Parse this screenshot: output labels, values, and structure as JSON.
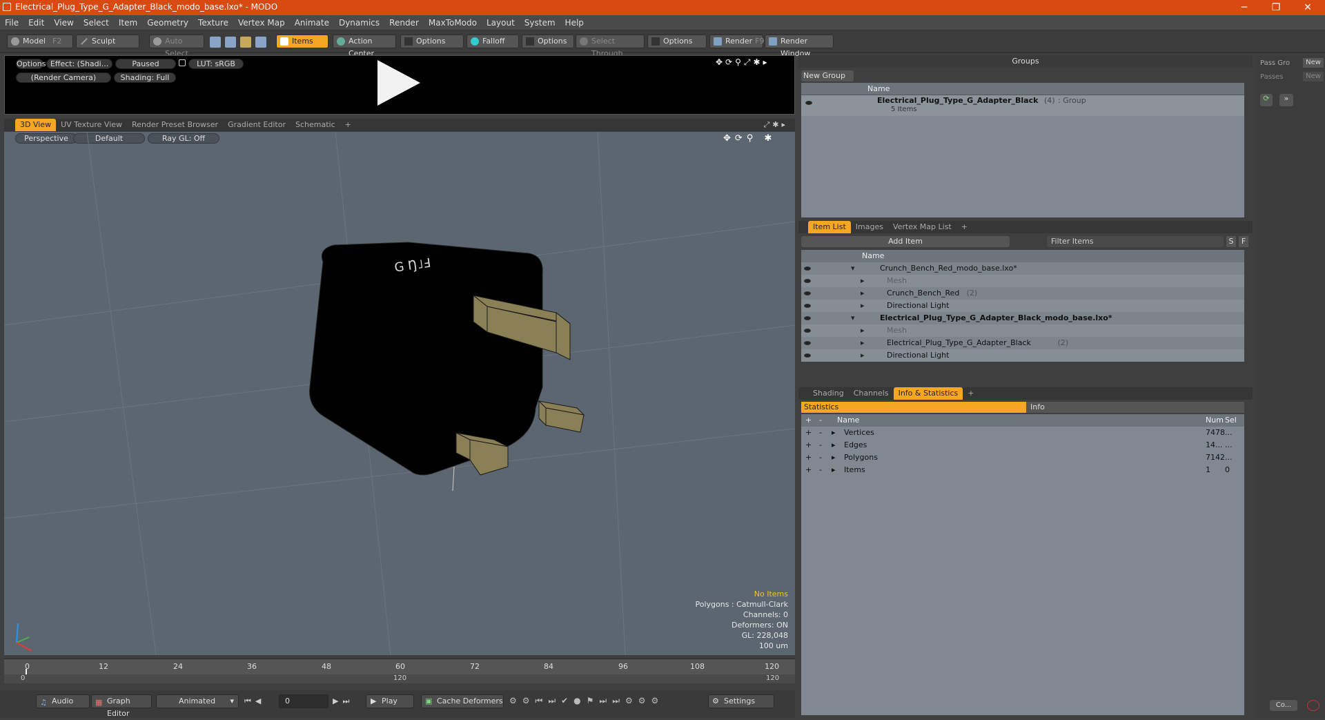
{
  "window": {
    "title": "Electrical_Plug_Type_G_Adapter_Black_modo_base.lxo* - MODO"
  },
  "menu": [
    "File",
    "Edit",
    "View",
    "Select",
    "Item",
    "Geometry",
    "Texture",
    "Vertex Map",
    "Animate",
    "Dynamics",
    "Render",
    "MaxToModo",
    "Layout",
    "System",
    "Help"
  ],
  "toolbar": {
    "model": "Model",
    "model_key": "F2",
    "sculpt": "Sculpt",
    "auto_select": "Auto Select",
    "items": "Items",
    "action_center": "Action Center",
    "options1": "Options",
    "falloff": "Falloff",
    "options2": "Options",
    "select_through": "Select Through",
    "options3": "Options",
    "render": "Render",
    "render_key": "F9",
    "render_window": "Render Window"
  },
  "preview": {
    "options": "Options",
    "effect": "Effect: (Shadi...",
    "paused": "Paused",
    "lut": "LUT: sRGB",
    "camera": "(Render Camera)",
    "shading": "Shading: Full"
  },
  "viewtabs": [
    "3D View",
    "UV Texture View",
    "Render Preset Browser",
    "Gradient Editor",
    "Schematic",
    "+"
  ],
  "viewport": {
    "perspective": "Perspective",
    "default": "Default",
    "raygl": "Ray GL: Off",
    "plug_text": "G Ŋ˩Ⅎ",
    "stats": [
      "No Items",
      "Polygons : Catmull-Clark",
      "Channels: 0",
      "Deformers: ON",
      "GL: 228,048",
      "100 um"
    ]
  },
  "timeline": {
    "ticks": [
      "0",
      "12",
      "24",
      "36",
      "48",
      "60",
      "72",
      "84",
      "96",
      "108",
      "120"
    ],
    "sub_start": "0",
    "sub_mid": "120",
    "sub_end": "120"
  },
  "bottom": {
    "audio": "Audio",
    "graph_editor": "Graph Editor",
    "animated": "Animated",
    "frame": "0",
    "play": "Play",
    "cache": "Cache Deformers",
    "settings": "Settings"
  },
  "groups": {
    "title": "Groups",
    "new_group": "New Group",
    "col_name": "Name",
    "item_name": "Electrical_Plug_Type_G_Adapter_Black",
    "item_count": "(4)",
    "item_type": ": Group",
    "item_sub": "5 Items"
  },
  "itemlist": {
    "tabs": [
      "Item List",
      "Images",
      "Vertex Map List",
      "+"
    ],
    "add_item": "Add Item",
    "filter": "Filter Items",
    "s": "S",
    "f": "F",
    "col_name": "Name",
    "rows": [
      {
        "label": "Crunch_Bench_Red_modo_base.lxo*",
        "indent": 0,
        "dim": false,
        "bold": false,
        "count": ""
      },
      {
        "label": "Mesh",
        "indent": 1,
        "dim": true,
        "bold": false,
        "count": ""
      },
      {
        "label": "Crunch_Bench_Red",
        "indent": 1,
        "dim": false,
        "bold": false,
        "count": "(2)"
      },
      {
        "label": "Directional Light",
        "indent": 1,
        "dim": false,
        "bold": false,
        "count": ""
      },
      {
        "label": "Electrical_Plug_Type_G_Adapter_Black_modo_base.lxo*",
        "indent": 0,
        "dim": false,
        "bold": true,
        "count": ""
      },
      {
        "label": "Mesh",
        "indent": 1,
        "dim": true,
        "bold": false,
        "count": ""
      },
      {
        "label": "Electrical_Plug_Type_G_Adapter_Black",
        "indent": 1,
        "dim": false,
        "bold": false,
        "count": "(2)"
      },
      {
        "label": "Directional Light",
        "indent": 1,
        "dim": false,
        "bold": false,
        "count": ""
      }
    ]
  },
  "stats_panel": {
    "tabs": [
      "Shading",
      "Channels",
      "Info & Statistics",
      "+"
    ],
    "statistics": "Statistics",
    "info": "Info",
    "cols": {
      "name": "Name",
      "num": "Num",
      "sel": "Sel"
    },
    "rows": [
      {
        "name": "Vertices",
        "num": "7478",
        "sel": "..."
      },
      {
        "name": "Edges",
        "num": "14...",
        "sel": "..."
      },
      {
        "name": "Polygons",
        "num": "7142",
        "sel": "..."
      },
      {
        "name": "Items",
        "num": "1",
        "sel": "0"
      }
    ]
  },
  "side": {
    "pass_group": "Pass Gro",
    "passes": "Passes",
    "new1": "New",
    "new2": "New",
    "co": "Co..."
  }
}
